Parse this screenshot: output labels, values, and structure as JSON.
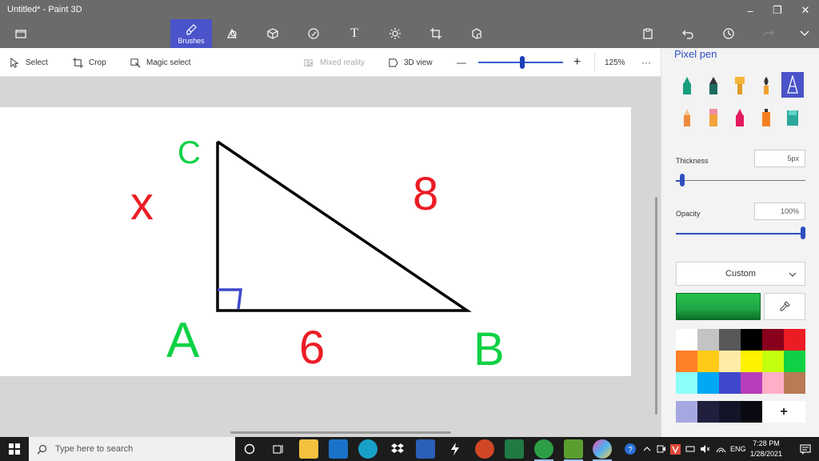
{
  "window": {
    "title": "Untitled* - Paint 3D",
    "minimize": "–",
    "maximize": "❐",
    "close": "✕"
  },
  "ribbon": {
    "brushes_label": "Brushes",
    "text_tool_glyph": "T"
  },
  "toolbar": {
    "select_label": "Select",
    "crop_label": "Crop",
    "magic_select_label": "Magic select",
    "mixed_reality_label": "Mixed reality",
    "view3d_label": "3D view",
    "zoom_value": "125%",
    "zoom_fraction": 0.52,
    "zoom_out": "—",
    "zoom_in": "+",
    "more": "···"
  },
  "canvas_labels": {
    "vertex_c": "C",
    "vertex_a": "A",
    "vertex_b": "B",
    "side_ac": "x",
    "side_ab": "6",
    "side_bc": "8"
  },
  "panel": {
    "title": "Pixel pen",
    "thickness_label": "Thickness",
    "thickness_value": "5px",
    "thickness_fraction": 0.05,
    "opacity_label": "Opacity",
    "opacity_value": "100%",
    "opacity_fraction": 1.0,
    "color_mode": "Custom",
    "add_color": "+"
  },
  "colors": {
    "accent": "#4a53c9",
    "current": "#1fa544",
    "palette": [
      "#ffffff",
      "#c3c3c3",
      "#585858",
      "#000000",
      "#88001b",
      "#ec1c24",
      "#ff7f27",
      "#ffca18",
      "#fdeca6",
      "#fff200",
      "#c4ff0e",
      "#0ed145",
      "#8cfffb",
      "#00a8f3",
      "#3f48cc",
      "#b83dba",
      "#ffaec8",
      "#b97a56"
    ],
    "custom": [
      "#a5a8e0",
      "#20203e",
      "#141428",
      "#0a0a12"
    ]
  },
  "taskbar": {
    "search_placeholder": "Type here to search",
    "language": "ENG",
    "time": "7:28 PM",
    "date": "1/28/2021"
  }
}
